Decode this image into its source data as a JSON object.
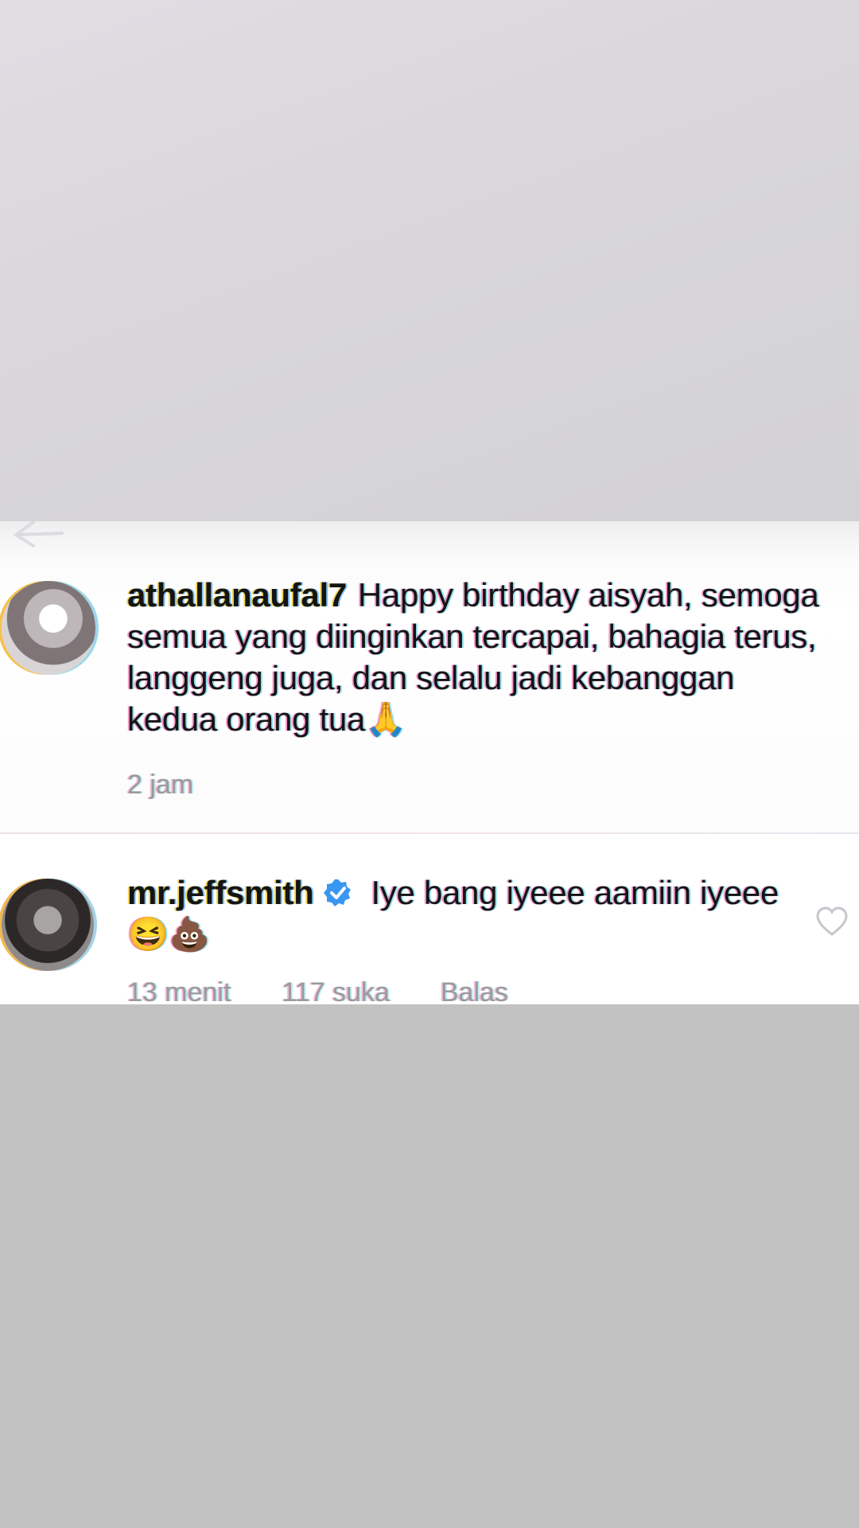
{
  "comments": [
    {
      "username": "athallanaufal7",
      "text": "Happy birthday aisyah, semoga semua yang diinginkan tercapai, bahagia terus, langgeng juga, dan selalu jadi kebanggan kedua orang tua🙏",
      "time": "2 jam"
    },
    {
      "username": "mr.jeffsmith",
      "verified": true,
      "text": "Iye bang iyeee aamiin iyeee 😆💩",
      "time": "13 menit",
      "likes": "117 suka",
      "reply_label": "Balas"
    }
  ],
  "icons": {
    "back": "back-arrow-icon",
    "verified": "verified-badge-icon",
    "like": "heart-icon"
  },
  "colors": {
    "verified_blue": "#3897f0",
    "meta_gray": "#9a9a9a",
    "text": "#141414"
  }
}
